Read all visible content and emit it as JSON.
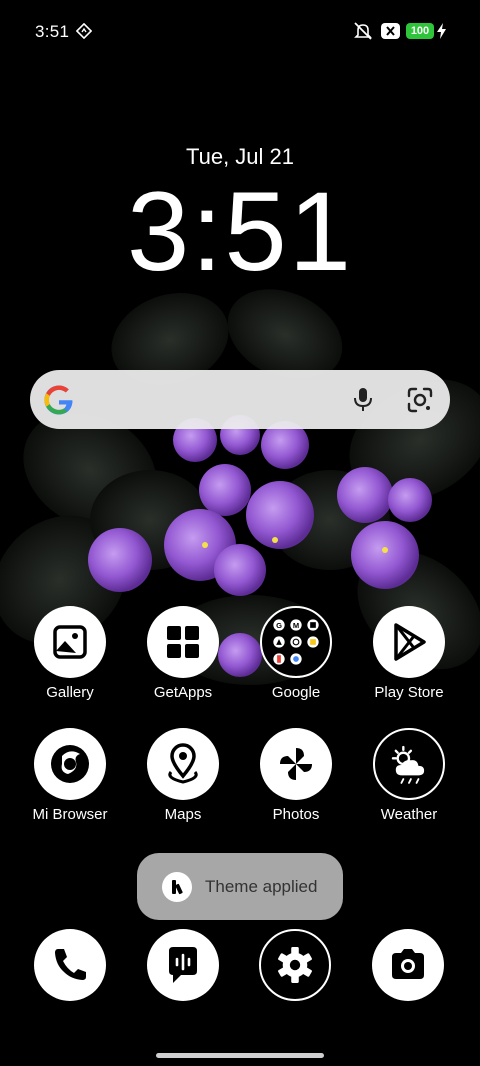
{
  "status_bar": {
    "time": "3:51",
    "battery_level": "100",
    "charging": true,
    "icons": [
      "navigation-diamond-icon",
      "mute-icon",
      "xbox-icon",
      "battery-icon",
      "charging-bolt-icon"
    ]
  },
  "clock_widget": {
    "date": "Tue, Jul 21",
    "time": "3:51"
  },
  "search_bar": {
    "icons": [
      "google-g-icon",
      "microphone-icon",
      "google-lens-icon"
    ]
  },
  "apps_row1": [
    {
      "label": "Gallery",
      "icon": "gallery-icon"
    },
    {
      "label": "GetApps",
      "icon": "getapps-icon"
    },
    {
      "label": "Google",
      "icon": "google-folder-icon"
    },
    {
      "label": "Play Store",
      "icon": "play-store-icon"
    }
  ],
  "apps_row2": [
    {
      "label": "Mi Browser",
      "icon": "mi-browser-icon"
    },
    {
      "label": "Maps",
      "icon": "maps-icon"
    },
    {
      "label": "Photos",
      "icon": "photos-icon"
    },
    {
      "label": "Weather",
      "icon": "weather-icon"
    }
  ],
  "toast": {
    "message": "Theme applied"
  },
  "dock": [
    "phone-icon",
    "messages-icon",
    "settings-icon",
    "camera-icon"
  ],
  "colors": {
    "background": "#000000",
    "battery": "#2fc53a",
    "flower": "#8a4fc7",
    "search_bar": "#ececec"
  }
}
